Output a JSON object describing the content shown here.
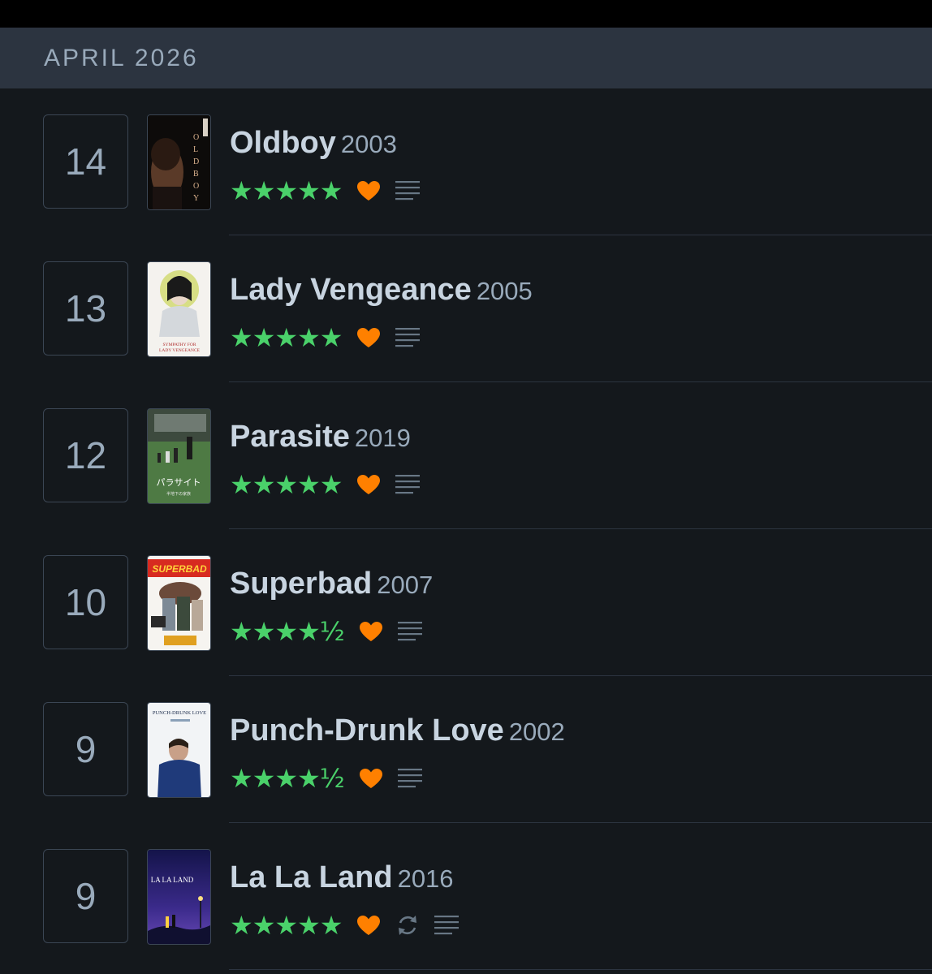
{
  "month_header": "APRIL 2026",
  "colors": {
    "background": "#14181c",
    "header": "#2c3440",
    "stars": "#4ad16a",
    "heart": "#ff8000",
    "text": "#c8d4e0"
  },
  "entries": [
    {
      "day": "14",
      "title": "Oldboy",
      "year": "2003",
      "stars": "★★★★★",
      "rating": 5,
      "liked": true,
      "rewatch": false,
      "review": true,
      "poster_text": "OLDBOY"
    },
    {
      "day": "13",
      "title": "Lady Vengeance",
      "year": "2005",
      "stars": "★★★★★",
      "rating": 5,
      "liked": true,
      "rewatch": false,
      "review": true,
      "poster_text": "SYMPATHY FOR LADY VENGEANCE"
    },
    {
      "day": "12",
      "title": "Parasite",
      "year": "2019",
      "stars": "★★★★★",
      "rating": 5,
      "liked": true,
      "rewatch": false,
      "review": true,
      "poster_text": "パラサイト"
    },
    {
      "day": "10",
      "title": "Superbad",
      "year": "2007",
      "stars": "★★★★½",
      "rating": 4.5,
      "liked": true,
      "rewatch": false,
      "review": true,
      "poster_text": "SUPERBAD"
    },
    {
      "day": "9",
      "title": "Punch-Drunk Love",
      "year": "2002",
      "stars": "★★★★½",
      "rating": 4.5,
      "liked": true,
      "rewatch": false,
      "review": true,
      "poster_text": "PUNCH-DRUNK LOVE"
    },
    {
      "day": "9",
      "title": "La La Land",
      "year": "2016",
      "stars": "★★★★★",
      "rating": 5,
      "liked": true,
      "rewatch": true,
      "review": true,
      "poster_text": "LA LA LAND"
    }
  ]
}
